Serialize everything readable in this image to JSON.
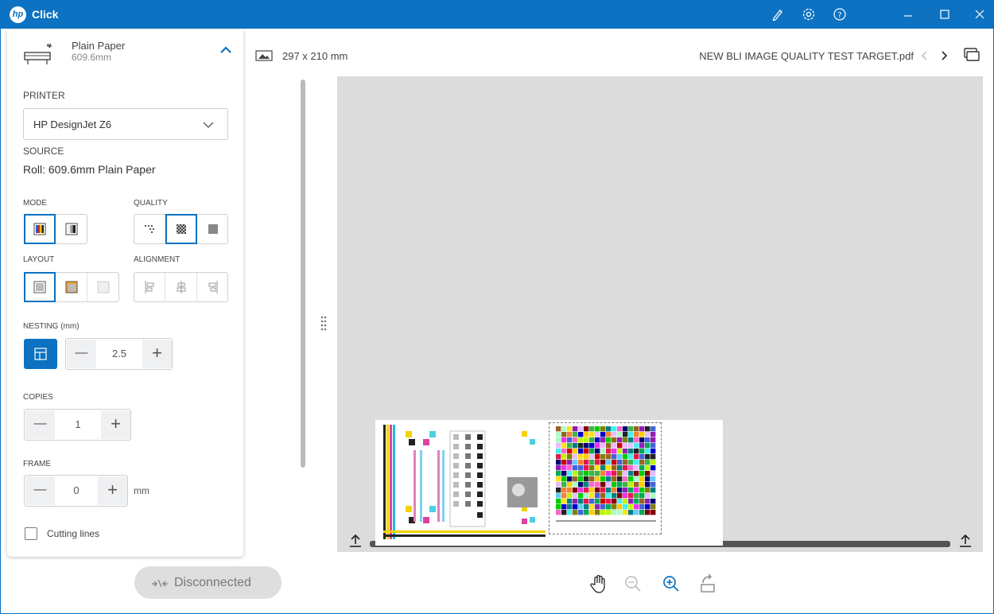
{
  "titlebar": {
    "logo_text": "hp",
    "app_title": "Click",
    "icons": [
      "pen-icon",
      "gear-icon",
      "help-icon",
      "minimize-icon",
      "maximize-icon",
      "close-icon"
    ]
  },
  "media": {
    "paper_name": "Plain Paper",
    "paper_width": "609.6mm"
  },
  "printer": {
    "label": "PRINTER",
    "selected": "HP DesignJet Z6"
  },
  "source": {
    "label": "SOURCE",
    "value": "Roll: 609.6mm Plain Paper"
  },
  "mode": {
    "label": "MODE",
    "options": [
      "color",
      "grayscale"
    ],
    "selected": "color"
  },
  "quality": {
    "label": "QUALITY",
    "options": [
      "draft",
      "normal",
      "best"
    ],
    "selected": "normal"
  },
  "layout": {
    "label": "LAYOUT",
    "options": [
      "actual-size",
      "fit",
      "custom"
    ],
    "selected": "actual-size"
  },
  "alignment": {
    "label": "ALIGNMENT",
    "options": [
      "left",
      "center",
      "right"
    ]
  },
  "nesting": {
    "label": "NESTING (mm)",
    "value": "2.5",
    "minus": "—",
    "plus": "+"
  },
  "copies": {
    "label": "COPIES",
    "value": "1",
    "minus": "—",
    "plus": "+"
  },
  "frame": {
    "label": "FRAME",
    "value": "0",
    "unit": "mm",
    "minus": "—",
    "plus": "+"
  },
  "cutting_lines": {
    "label": "Cutting lines",
    "checked": false
  },
  "status": {
    "label": "Disconnected"
  },
  "preview": {
    "page_size": "297 x 210 mm",
    "file_name": "NEW BLI IMAGE QUALITY TEST TARGET.pdf"
  },
  "colors": {
    "accent": "#0c72c1",
    "canvas": "#dcdcdc"
  }
}
